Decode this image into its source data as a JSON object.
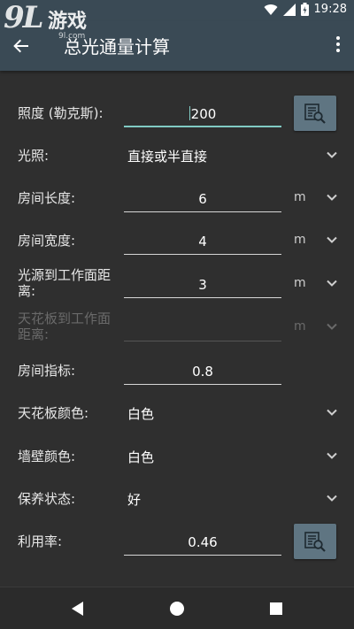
{
  "status": {
    "time": "19:28"
  },
  "watermark": {
    "logo": "9L",
    "brand": "游戏",
    "url": "9l.com"
  },
  "toolbar": {
    "title": "总光通量计算"
  },
  "form": {
    "illuminance": {
      "label": "照度 (勒克斯):",
      "value": "200"
    },
    "lighting": {
      "label": "光照:",
      "value": "直接或半直接"
    },
    "room_length": {
      "label": "房间长度:",
      "value": "6",
      "unit": "m"
    },
    "room_width": {
      "label": "房间宽度:",
      "value": "4",
      "unit": "m"
    },
    "light_to_work": {
      "label": "光源到工作面距离:",
      "value": "3",
      "unit": "m"
    },
    "ceiling_to_work": {
      "label": "天花板到工作面距离:",
      "value": "",
      "unit": "m"
    },
    "room_index": {
      "label": "房间指标:",
      "value": "0.8"
    },
    "ceiling_color": {
      "label": "天花板颜色:",
      "value": "白色"
    },
    "wall_color": {
      "label": "墙壁颜色:",
      "value": "白色"
    },
    "maintenance": {
      "label": "保养状态:",
      "value": "好"
    },
    "utilization": {
      "label": "利用率:",
      "value": "0.46"
    }
  },
  "colors": {
    "toolbar": "#3a4a55",
    "background": "#2f2f2f",
    "accent": "#80cbc4",
    "button": "#5f7582"
  }
}
